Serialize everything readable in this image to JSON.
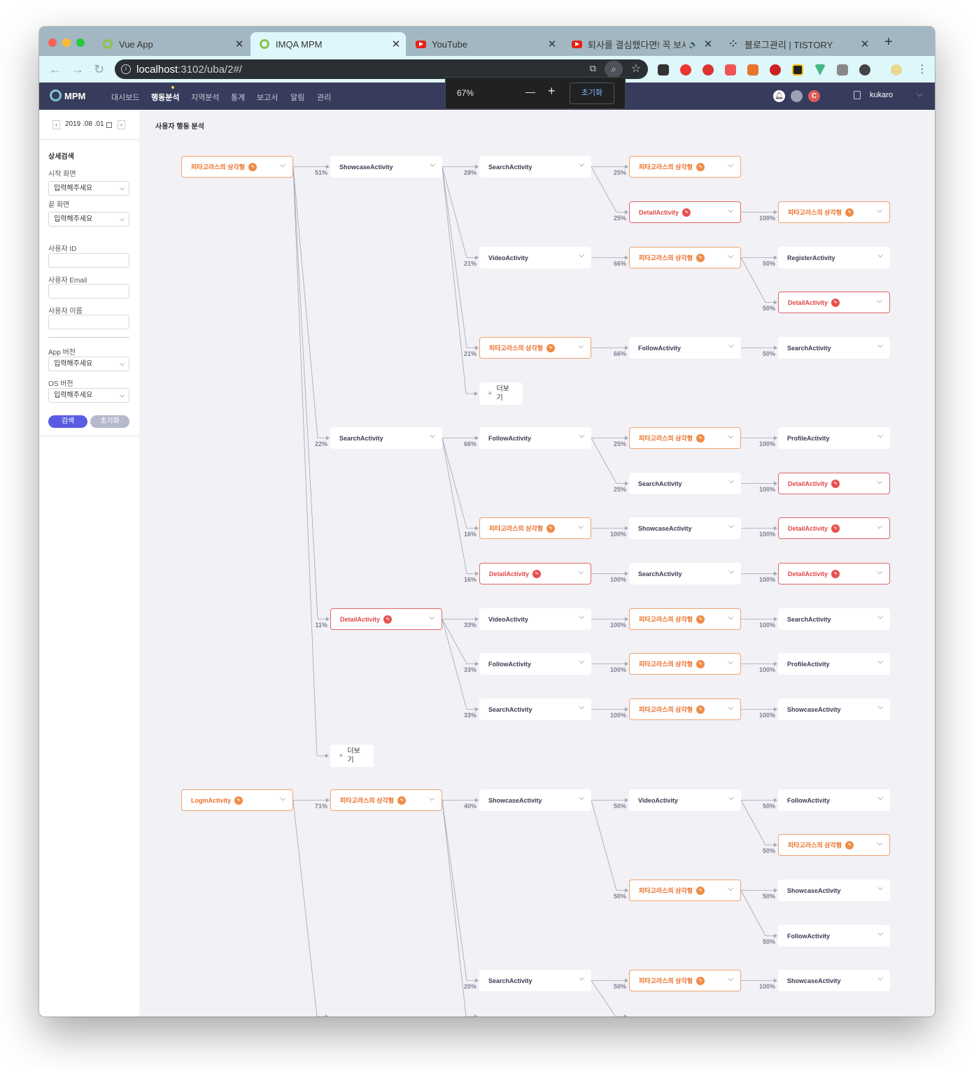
{
  "browser": {
    "tabs": [
      {
        "title": "Vue App",
        "icon": "q-logo-icon"
      },
      {
        "title": "IMQA MPM",
        "icon": "q-logo-icon"
      },
      {
        "title": "YouTube",
        "icon": "youtube-icon"
      },
      {
        "title": "퇴사를 결심했다면! 꼭 보세요",
        "icon": "youtube-icon"
      },
      {
        "title": "블로그관리 | TISTORY",
        "icon": "tistory-icon"
      }
    ],
    "new_tab": "+",
    "address_host": "localhost",
    "address_rest": ":3102/uba/2#/"
  },
  "zoom_popup": {
    "value": "67%",
    "minus": "—",
    "plus": "+",
    "reset": "초기화"
  },
  "app": {
    "logo": "MPM",
    "menu": [
      "대시보드",
      "행동분석",
      "지역분석",
      "통계",
      "보고서",
      "알림",
      "관리"
    ],
    "active_menu": "행동분석",
    "user": "kukaro",
    "avatar_letter": "C"
  },
  "sidebar": {
    "date": "2019 .08 .01",
    "section_title": "상세검색",
    "start_screen_label": "시작 화면",
    "end_screen_label": "끝 화면",
    "select_placeholder": "입력해주세요",
    "user_id_label": "사용자 ID",
    "user_email_label": "사용자 Email",
    "user_name_label": "사용자 이름",
    "app_version_label": "App 버전",
    "os_version_label": "OS 버전",
    "search_button": "검색",
    "reset_button": "초기화"
  },
  "main": {
    "title": "사용자 행동 분석",
    "more_label_1": "더보",
    "more_label_2": "기",
    "nodes": [
      {
        "label": "피타고라스의 삼각형",
        "style": "orange"
      },
      {
        "label": "ShowcaseActivity",
        "style": "plain"
      },
      {
        "label": "SearchActivity",
        "style": "plain"
      },
      {
        "label": "피타고라스의 삼각형",
        "style": "orange"
      },
      {
        "label": "DetailActivity",
        "style": "red"
      },
      {
        "label": "피타고라스의 삼각형",
        "style": "orange"
      },
      {
        "label": "VideoActivity",
        "style": "plain"
      },
      {
        "label": "피타고라스의 삼각형",
        "style": "orange"
      },
      {
        "label": "RegisterActivity",
        "style": "plain"
      },
      {
        "label": "DetailActivity",
        "style": "red"
      },
      {
        "label": "피타고라스의 삼각형",
        "style": "orange"
      },
      {
        "label": "FollowActivity",
        "style": "plain"
      },
      {
        "label": "SearchActivity",
        "style": "plain"
      },
      {
        "label": "SearchActivity",
        "style": "plain"
      },
      {
        "label": "FollowActivity",
        "style": "plain"
      },
      {
        "label": "피타고라스의 삼각형",
        "style": "orange"
      },
      {
        "label": "ProfileActivity",
        "style": "plain"
      },
      {
        "label": "SearchActivity",
        "style": "plain"
      },
      {
        "label": "DetailActivity",
        "style": "red"
      },
      {
        "label": "피타고라스의 삼각형",
        "style": "orange"
      },
      {
        "label": "ShowcaseActivity",
        "style": "plain"
      },
      {
        "label": "DetailActivity",
        "style": "red"
      },
      {
        "label": "DetailActivity",
        "style": "red"
      },
      {
        "label": "SearchActivity",
        "style": "plain"
      },
      {
        "label": "DetailActivity",
        "style": "red"
      },
      {
        "label": "DetailActivity",
        "style": "red"
      },
      {
        "label": "VideoActivity",
        "style": "plain"
      },
      {
        "label": "피타고라스의 삼각형",
        "style": "orange"
      },
      {
        "label": "SearchActivity",
        "style": "plain"
      },
      {
        "label": "FollowActivity",
        "style": "plain"
      },
      {
        "label": "피타고라스의 삼각형",
        "style": "orange"
      },
      {
        "label": "ProfileActivity",
        "style": "plain"
      },
      {
        "label": "SearchActivity",
        "style": "plain"
      },
      {
        "label": "피타고라스의 삼각형",
        "style": "orange"
      },
      {
        "label": "ShowcaseActivity",
        "style": "plain"
      },
      {
        "label": "LoginActivity",
        "style": "orange"
      },
      {
        "label": "피타고라스의 삼각형",
        "style": "orange"
      },
      {
        "label": "ShowcaseActivity",
        "style": "plain"
      },
      {
        "label": "VideoActivity",
        "style": "plain"
      },
      {
        "label": "FollowActivity",
        "style": "plain"
      },
      {
        "label": "피타고라스의 삼각형",
        "style": "orange"
      },
      {
        "label": "피타고라스의 삼각형",
        "style": "orange"
      },
      {
        "label": "ShowcaseActivity",
        "style": "plain"
      },
      {
        "label": "FollowActivity",
        "style": "plain"
      },
      {
        "label": "SearchActivity",
        "style": "plain"
      },
      {
        "label": "피타고라스의 삼각형",
        "style": "orange"
      },
      {
        "label": "ShowcaseActivity",
        "style": "plain"
      }
    ],
    "percents": [
      "51%",
      "28%",
      "25%",
      "25%",
      "100%",
      "21%",
      "66%",
      "50%",
      "50%",
      "21%",
      "66%",
      "50%",
      "22%",
      "66%",
      "25%",
      "100%",
      "25%",
      "100%",
      "16%",
      "100%",
      "100%",
      "16%",
      "100%",
      "100%",
      "11%",
      "33%",
      "100%",
      "100%",
      "33%",
      "100%",
      "100%",
      "33%",
      "100%",
      "100%",
      "71%",
      "40%",
      "50%",
      "50%",
      "50%",
      "50%",
      "50%",
      "50%",
      "20%",
      "50%",
      "100%"
    ]
  }
}
